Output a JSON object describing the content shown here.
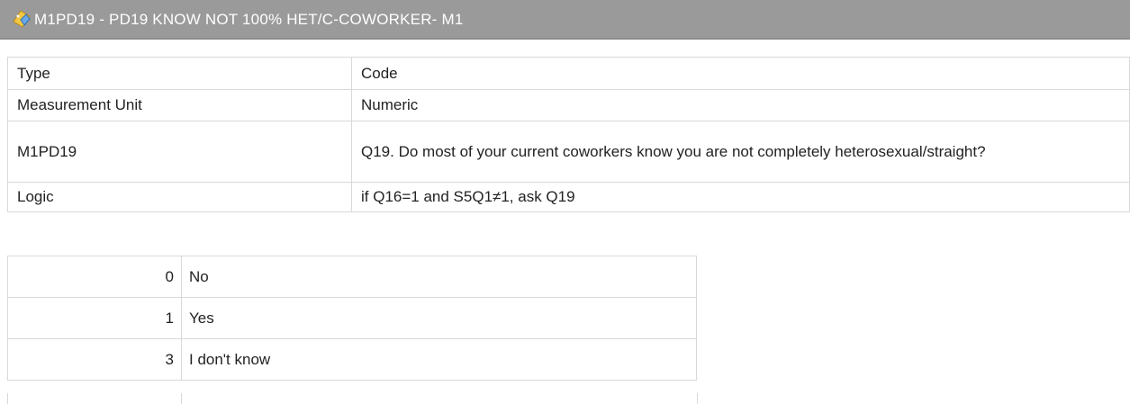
{
  "header": {
    "title": "M1PD19 - PD19 KNOW NOT 100% HET/C-COWORKER- M1",
    "icon": "variable-icon"
  },
  "info_rows": [
    {
      "label": "Type",
      "value": "Code"
    },
    {
      "label": "Measurement Unit",
      "value": "Numeric"
    },
    {
      "label": "M1PD19",
      "value": "Q19. Do most of your current coworkers know you are not completely heterosexual/straight?"
    },
    {
      "label": "Logic",
      "value": "if Q16=1 and S5Q1≠1, ask Q19"
    }
  ],
  "codes": [
    {
      "code": "0",
      "label": "No"
    },
    {
      "code": "1",
      "label": "Yes"
    },
    {
      "code": "3",
      "label": "I don't know"
    }
  ]
}
